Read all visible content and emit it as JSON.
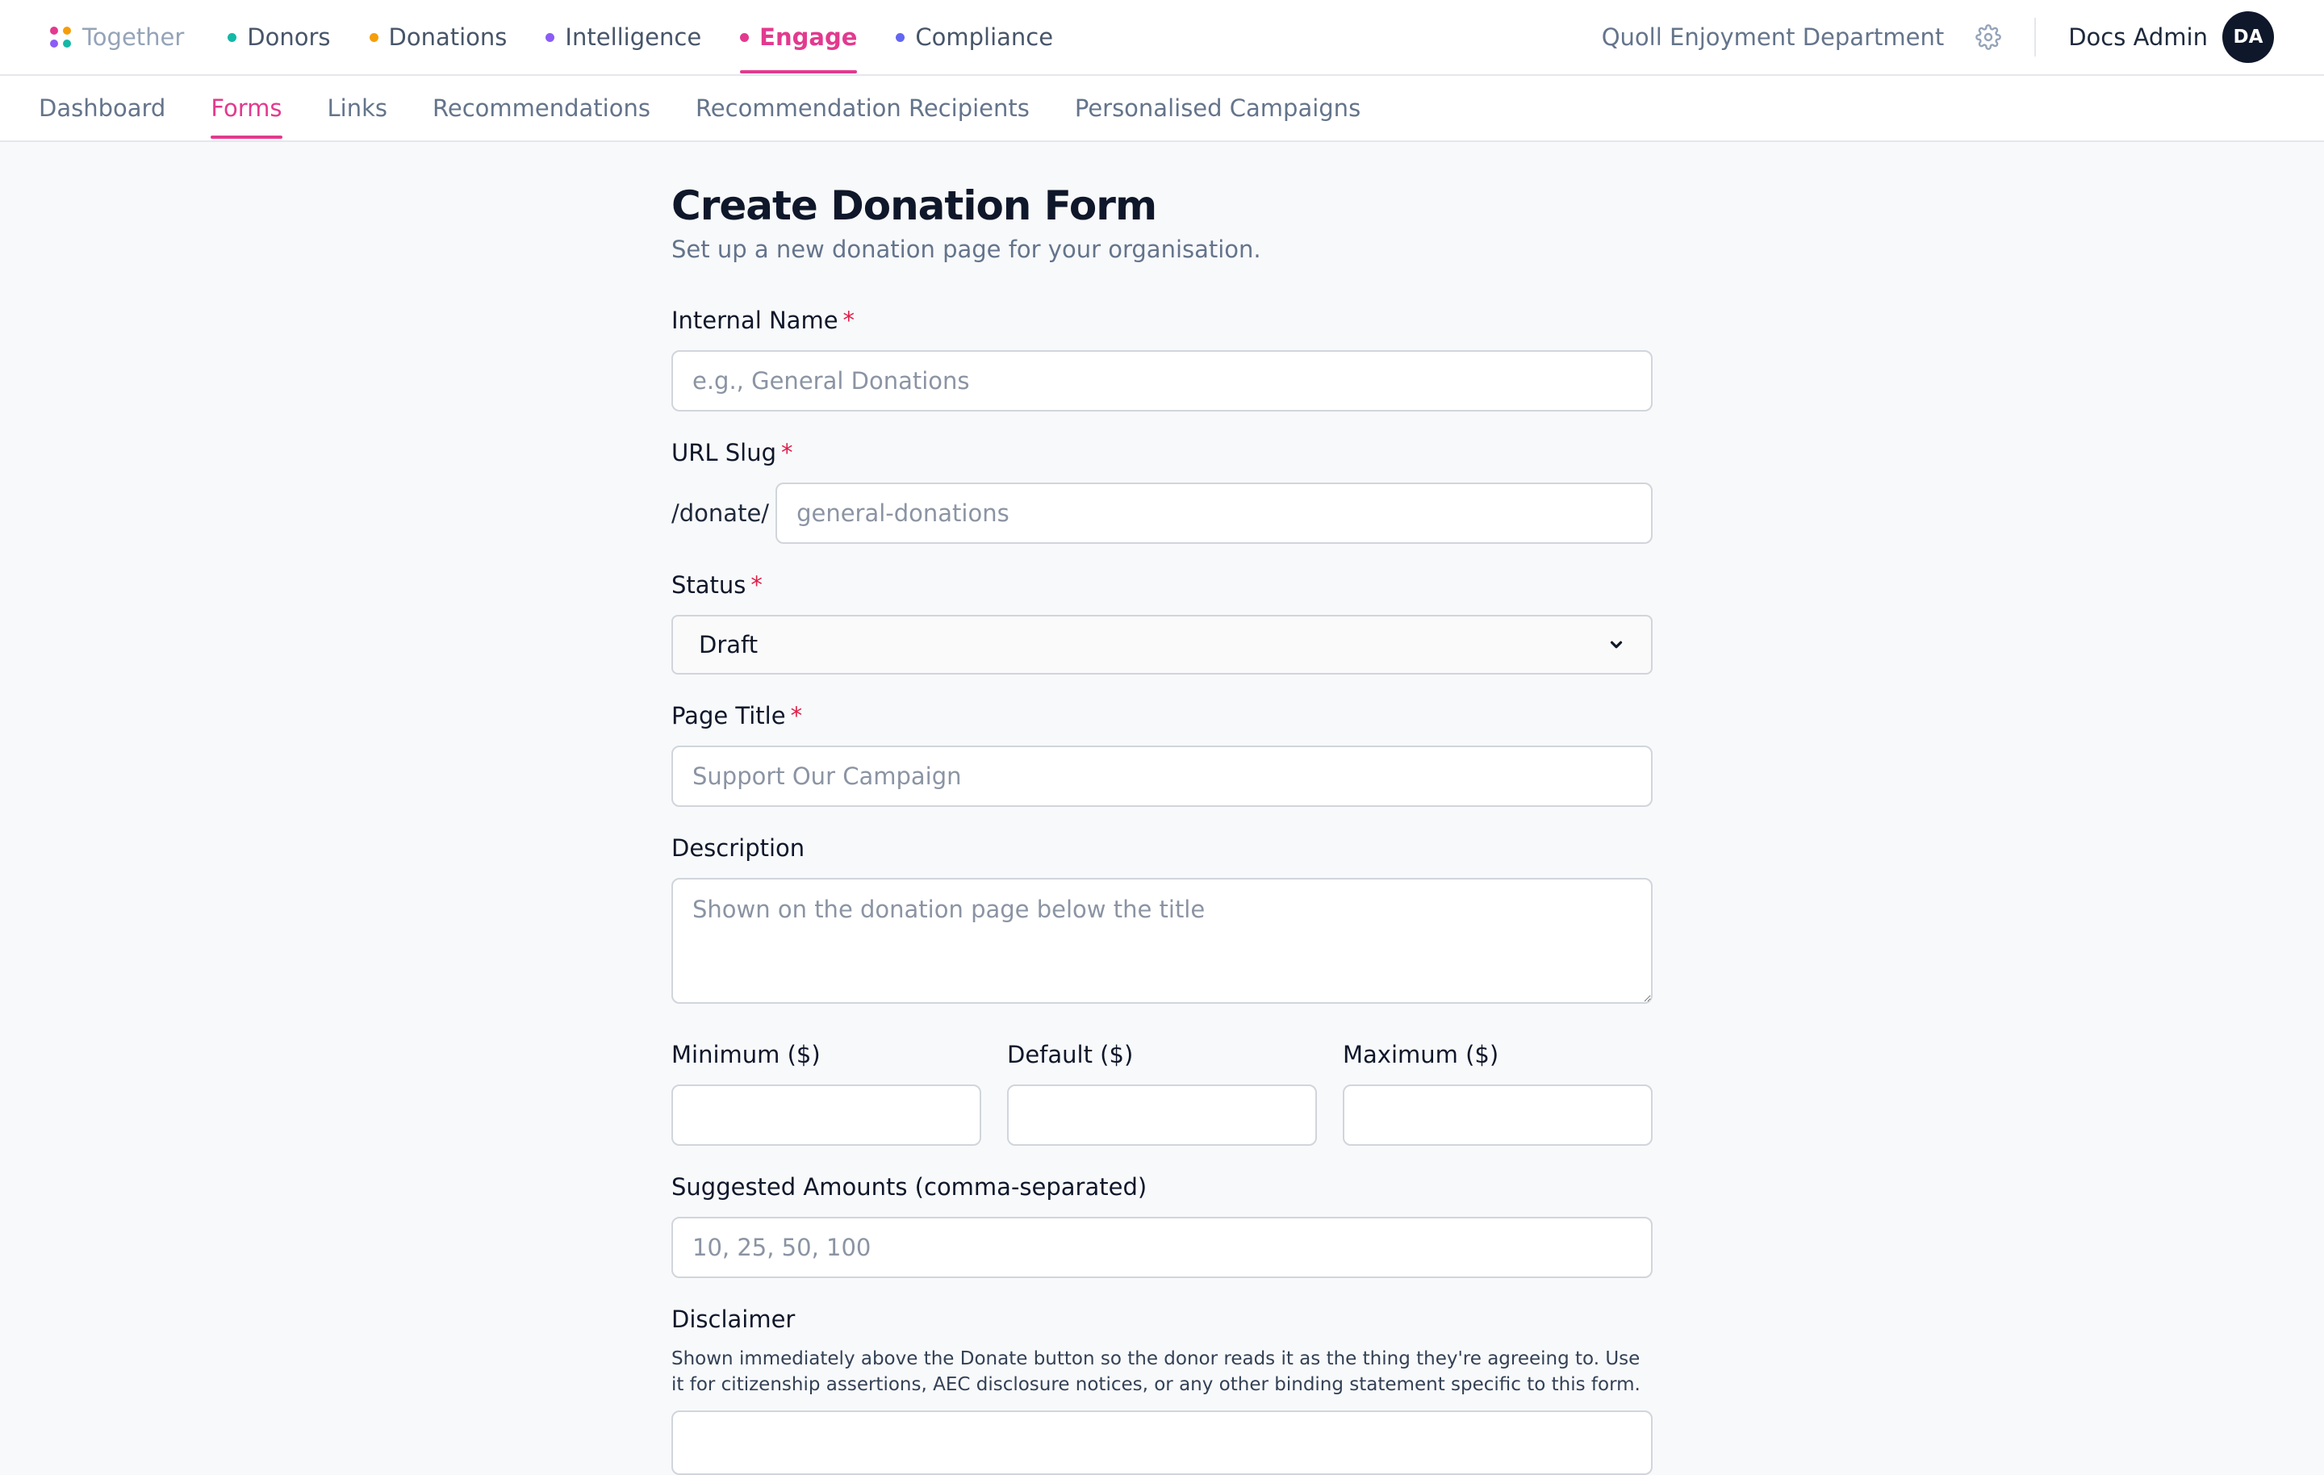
{
  "nav": {
    "brand": "Together",
    "logo_colors": [
      "#e23a8e",
      "#f59e0b",
      "#8b5cf6",
      "#14b8a6"
    ],
    "items": [
      {
        "label": "Donors",
        "color": "#14b8a6"
      },
      {
        "label": "Donations",
        "color": "#f59e0b"
      },
      {
        "label": "Intelligence",
        "color": "#8b5cf6"
      },
      {
        "label": "Engage",
        "color": "#e23a8e"
      },
      {
        "label": "Compliance",
        "color": "#6366f1"
      }
    ],
    "active": "Engage",
    "org_name": "Quoll Enjoyment Department",
    "settings_icon": "gear-icon",
    "user_name": "Docs Admin",
    "user_initials": "DA"
  },
  "subnav": {
    "items": [
      "Dashboard",
      "Forms",
      "Links",
      "Recommendations",
      "Recommendation Recipients",
      "Personalised Campaigns"
    ],
    "active": "Forms"
  },
  "form": {
    "title": "Create Donation Form",
    "subtitle": "Set up a new donation page for your organisation.",
    "required_marker": "*",
    "internal_name": {
      "label": "Internal Name",
      "placeholder": "e.g., General Donations",
      "value": ""
    },
    "url_slug": {
      "label": "URL Slug",
      "prefix": "/donate/",
      "placeholder": "general-donations",
      "value": ""
    },
    "status": {
      "label": "Status",
      "value": "Draft"
    },
    "page_title": {
      "label": "Page Title",
      "placeholder": "Support Our Campaign",
      "value": ""
    },
    "description": {
      "label": "Description",
      "placeholder": "Shown on the donation page below the title",
      "value": ""
    },
    "minimum": {
      "label": "Minimum ($)",
      "value": ""
    },
    "default": {
      "label": "Default ($)",
      "value": ""
    },
    "maximum": {
      "label": "Maximum ($)",
      "value": ""
    },
    "suggested": {
      "label": "Suggested Amounts (comma-separated)",
      "placeholder": "10, 25, 50, 100",
      "value": ""
    },
    "disclaimer": {
      "label": "Disclaimer",
      "help": "Shown immediately above the Donate button so the donor reads it as the thing they're agreeing to. Use it for citizenship assertions, AEC disclosure notices, or any other binding statement specific to this form."
    }
  }
}
